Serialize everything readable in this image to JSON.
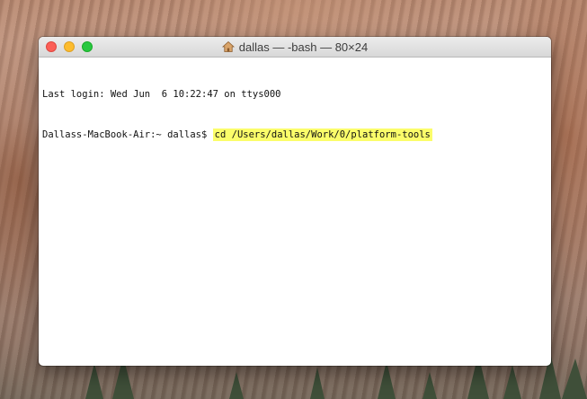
{
  "window": {
    "title": "dallas — -bash — 80×24",
    "title_icon": "home-folder-icon"
  },
  "terminal": {
    "lines": [
      "Last login: Wed Jun  6 10:22:47 on ttys000"
    ],
    "prompt": "Dallass-MacBook-Air:~ dallas$ ",
    "command": "cd /Users/dallas/Work/0/platform-tools",
    "command_highlight_color": "#fbfd6a"
  },
  "colors": {
    "close": "#fc5f57",
    "minimize": "#fdbc2e",
    "zoom": "#28c840"
  }
}
